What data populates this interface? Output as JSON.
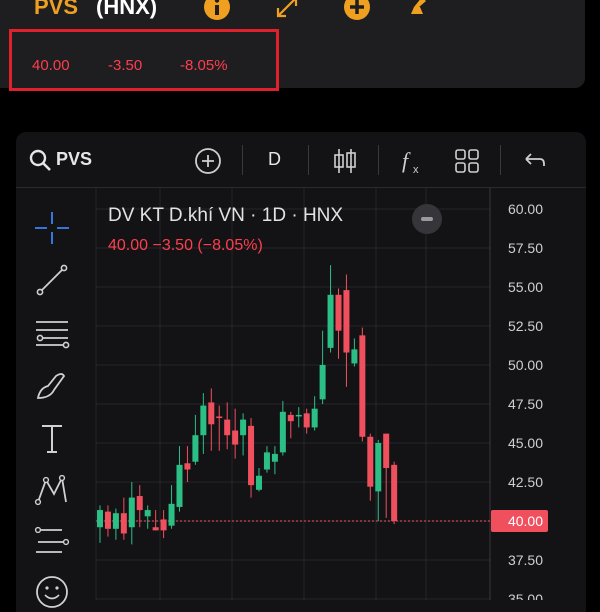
{
  "header": {
    "ticker": "PVS",
    "exchange": "(HNX)"
  },
  "quote": {
    "price": "40.00",
    "change": "-3.50",
    "change_pct": "-8.05%"
  },
  "toolbar": {
    "symbol": "PVS",
    "interval": "D"
  },
  "chart_header": {
    "title": "DV KT D.khí VN · 1D · HNX",
    "ohlc_line": "40.00  −3.50 (−8.05%)"
  },
  "colors": {
    "up": "#2bbf86",
    "down": "#f0505e",
    "accent": "#f0a020"
  },
  "chart_data": {
    "type": "candlestick",
    "y_ticks": [
      "60.00",
      "57.50",
      "55.00",
      "52.50",
      "50.00",
      "47.50",
      "45.00",
      "42.50",
      "40.00",
      "37.50",
      "35.00"
    ],
    "ylim": [
      35.0,
      60.0
    ],
    "last_price_label": "40.00",
    "candles": [
      {
        "o": 39.6,
        "c": 40.7,
        "h": 41.0,
        "l": 38.6
      },
      {
        "o": 40.6,
        "c": 39.5,
        "h": 41.0,
        "l": 39.0
      },
      {
        "o": 39.5,
        "c": 40.5,
        "h": 40.8,
        "l": 38.8
      },
      {
        "o": 40.5,
        "c": 39.2,
        "h": 41.5,
        "l": 38.8
      },
      {
        "o": 39.6,
        "c": 41.5,
        "h": 42.5,
        "l": 38.5
      },
      {
        "o": 41.6,
        "c": 40.7,
        "h": 42.3,
        "l": 39.6
      },
      {
        "o": 40.3,
        "c": 40.7,
        "h": 41.0,
        "l": 39.5
      },
      {
        "o": 39.6,
        "c": 39.4,
        "h": 40.7,
        "l": 39.4
      },
      {
        "o": 40.1,
        "c": 39.4,
        "h": 40.7,
        "l": 38.9
      },
      {
        "o": 39.7,
        "c": 41.1,
        "h": 42.3,
        "l": 39.5
      },
      {
        "o": 40.9,
        "c": 43.6,
        "h": 44.8,
        "l": 40.6
      },
      {
        "o": 43.7,
        "c": 43.3,
        "h": 44.8,
        "l": 42.5
      },
      {
        "o": 43.8,
        "c": 45.5,
        "h": 46.8,
        "l": 43.6
      },
      {
        "o": 45.5,
        "c": 47.4,
        "h": 48.2,
        "l": 44.3
      },
      {
        "o": 47.6,
        "c": 46.2,
        "h": 48.5,
        "l": 44.5
      },
      {
        "o": 46.7,
        "c": 46.6,
        "h": 47.4,
        "l": 44.5
      },
      {
        "o": 46.5,
        "c": 45.5,
        "h": 47.6,
        "l": 44.6
      },
      {
        "o": 45.8,
        "c": 44.9,
        "h": 47.2,
        "l": 44.0
      },
      {
        "o": 45.5,
        "c": 46.5,
        "h": 46.9,
        "l": 44.2
      },
      {
        "o": 46.1,
        "c": 42.3,
        "h": 46.6,
        "l": 41.5
      },
      {
        "o": 42.0,
        "c": 42.9,
        "h": 43.4,
        "l": 41.9
      },
      {
        "o": 43.3,
        "c": 44.4,
        "h": 44.8,
        "l": 43.1
      },
      {
        "o": 43.8,
        "c": 44.3,
        "h": 44.8,
        "l": 43.0
      },
      {
        "o": 44.4,
        "c": 47.0,
        "h": 47.7,
        "l": 44.2
      },
      {
        "o": 46.8,
        "c": 46.4,
        "h": 47.0,
        "l": 45.3
      },
      {
        "o": 46.8,
        "c": 46.8,
        "h": 47.3,
        "l": 46.0
      },
      {
        "o": 46.9,
        "c": 46.0,
        "h": 47.2,
        "l": 45.6
      },
      {
        "o": 46.0,
        "c": 47.2,
        "h": 48.0,
        "l": 45.8
      },
      {
        "o": 47.8,
        "c": 50.0,
        "h": 52.2,
        "l": 47.5
      },
      {
        "o": 51.1,
        "c": 54.5,
        "h": 56.4,
        "l": 50.8
      },
      {
        "o": 54.5,
        "c": 52.2,
        "h": 54.9,
        "l": 50.4
      },
      {
        "o": 54.8,
        "c": 50.8,
        "h": 55.8,
        "l": 48.6
      },
      {
        "o": 50.1,
        "c": 51.0,
        "h": 51.7,
        "l": 49.9
      },
      {
        "o": 51.9,
        "c": 45.4,
        "h": 52.4,
        "l": 45.1
      },
      {
        "o": 45.4,
        "c": 42.2,
        "h": 45.6,
        "l": 41.3
      },
      {
        "o": 41.9,
        "c": 45.0,
        "h": 45.2,
        "l": 40.0
      },
      {
        "o": 45.6,
        "c": 43.4,
        "h": 45.6,
        "l": 40.2
      },
      {
        "o": 43.6,
        "c": 40.0,
        "h": 43.8,
        "l": 39.8
      }
    ]
  }
}
